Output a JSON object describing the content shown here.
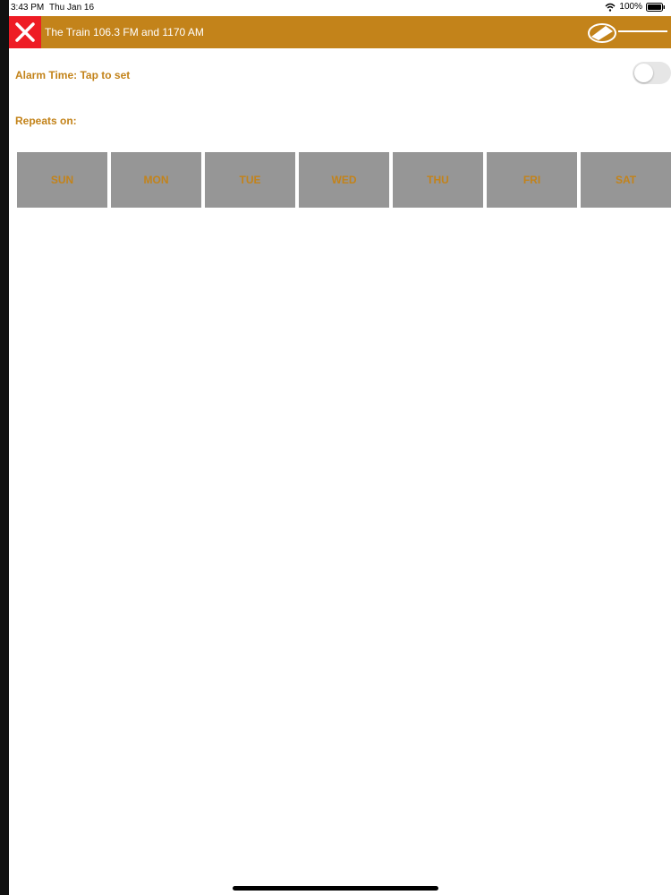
{
  "status_bar": {
    "time": "3:43 PM",
    "date": "Thu Jan 16",
    "battery": "100%",
    "icons": [
      "wifi-icon",
      "battery-icon"
    ]
  },
  "header": {
    "title": "The Train 106.3 FM and 1170 AM",
    "close_icon": "close-icon",
    "logo": "station-logo"
  },
  "alarm": {
    "time_label": "Alarm Time: Tap to set",
    "enabled": false
  },
  "repeat": {
    "label": "Repeats on:",
    "days": [
      "SUN",
      "MON",
      "TUE",
      "WED",
      "THU",
      "FRI",
      "SAT"
    ]
  },
  "colors": {
    "accent": "#c3831a",
    "close_bg": "#ee1c24",
    "day_bg": "#969696",
    "toggle_off": "#e6e6e6"
  }
}
